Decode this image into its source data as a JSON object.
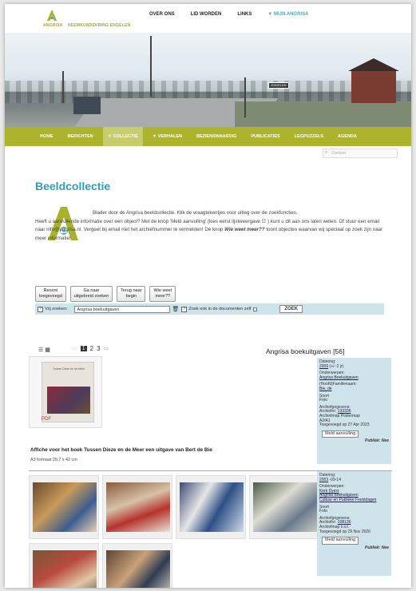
{
  "site": {
    "logo_letter": "A",
    "logo_name": "ANGRISA",
    "logo_subtitle": "HEEMKUNDEKRING ENGELEN",
    "accent_green": "#acb32d",
    "accent_teal": "#2f9db3"
  },
  "topnav": [
    "OVER ONS",
    "LID WORDEN",
    "LINKS",
    "▼ MIJN ANGRISA"
  ],
  "banner": {
    "sign_text": "ENGELEN"
  },
  "mainnav": [
    "HOME",
    "BERICHTEN",
    "▼ COLLECTIE",
    "▼ VERHALEN",
    "BEZIENSWAARDIG",
    "PUBLICATIES",
    "LEGPUZZELS",
    "AGENDA"
  ],
  "search": {
    "placeholder": "Zoeken"
  },
  "page_title": "Beeldcollectie",
  "intro": {
    "line1": "Blader door de Angrisa beeldcollectie. Klik de vraagtekentjes voor uitleg over de zoekfuncties.",
    "line2a": "Heeft u aanvullende informatie over een object? Met de knop 'Meld aanvulling' (kies eerst lijstweergave",
    "line2b": "kunt u dit aan ons laten weten. Of stuur een email naar info@angrisa.nl. Vergeet bij email niet het",
    "line2c": "archiefnummer te vermelden! De knop ",
    "em": "Wie weet meer??",
    "line2d": " toont objecten waarvan wij speciaal op zoek zijn naar meer informatie!"
  },
  "buttons": [
    {
      "l1": "Recent",
      "l2": "toegevoegd"
    },
    {
      "l1": "Ga naar",
      "l2": "uitgebreid zoeken"
    },
    {
      "l1": "Terug naar",
      "l2": "begin"
    },
    {
      "l1": "Wie weet",
      "l2": "meer??"
    }
  ],
  "filter": {
    "label": "Vrij zoeken:",
    "value": "Angrisa boekuitgaven",
    "doc_label": "Zoek ook in de documenten zelf",
    "submit": "ZOEK"
  },
  "results": {
    "pages": [
      "1",
      "2",
      "3"
    ],
    "title": "Angrisa boekuitgaven",
    "count": "[56]"
  },
  "item1": {
    "book_title": "Tussen Dieze en de Meer",
    "pdf_label": "PDF",
    "title": "Affiche voor het boek Tussen Dieze en de Meer een uitgave van Bert de Bie",
    "subtitle": "A3 formaat 29,7 x 42 cm",
    "meta": {
      "dating_label": "Datering:",
      "dating": "2009",
      "dating_extra": "(+/- 2 jr)",
      "subjects_label": "Onderwerpen:",
      "subjects": [
        "Angrisa Boekuitgaven"
      ],
      "families_label": "(Hoofd)Familienaam:",
      "family": "Bie, de",
      "type_label": "Soort",
      "type": "Foto",
      "archive_label": "Archiefgegevens:",
      "archive_no_label": "Archiefnr:",
      "archive_no": "133336",
      "map_label": "Archiefmap Postermap",
      "map": "A2/A1",
      "added": "Toegevoegd op 27 Apr 2023",
      "button": "Meld aanvulling",
      "public": "Publiek: Nee"
    }
  },
  "item2": {
    "meta": {
      "dating_label": "Datering:",
      "dating": "2003",
      "dating_extra": "-09-14",
      "subjects_label": "Onderwerpen:",
      "subjects": [
        "Kerk Dyers",
        "Angrisa Boekuitgaven",
        "Cultuur en Publieke Feestdagen"
      ],
      "type_label": "Soort",
      "type": "Foto",
      "archive_label": "Archiefgegevens:",
      "archive_no_label": "Archiefnr:",
      "archive_no": "108136",
      "map_label": "Archiefmap n.v.t.",
      "added": "Toegevoegd op 29 Nov 2020",
      "button": "Meld aanvulling",
      "public": "Publiek: Nee"
    }
  }
}
